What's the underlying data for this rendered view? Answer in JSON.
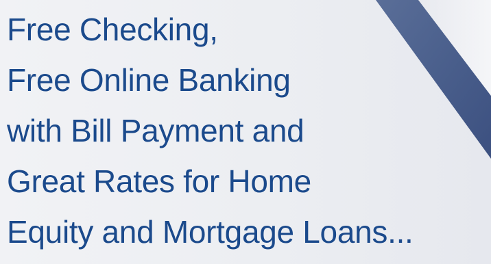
{
  "banner": {
    "colors": {
      "text": "#1b4a8c",
      "background": "#eceef2",
      "ribbon": "#4a5f8c"
    },
    "decoration": "diagonal-ribbon",
    "lines": [
      "Free Checking,",
      "Free Online Banking",
      "with Bill Payment and",
      "Great Rates for Home",
      "Equity and Mortgage Loans..."
    ]
  }
}
